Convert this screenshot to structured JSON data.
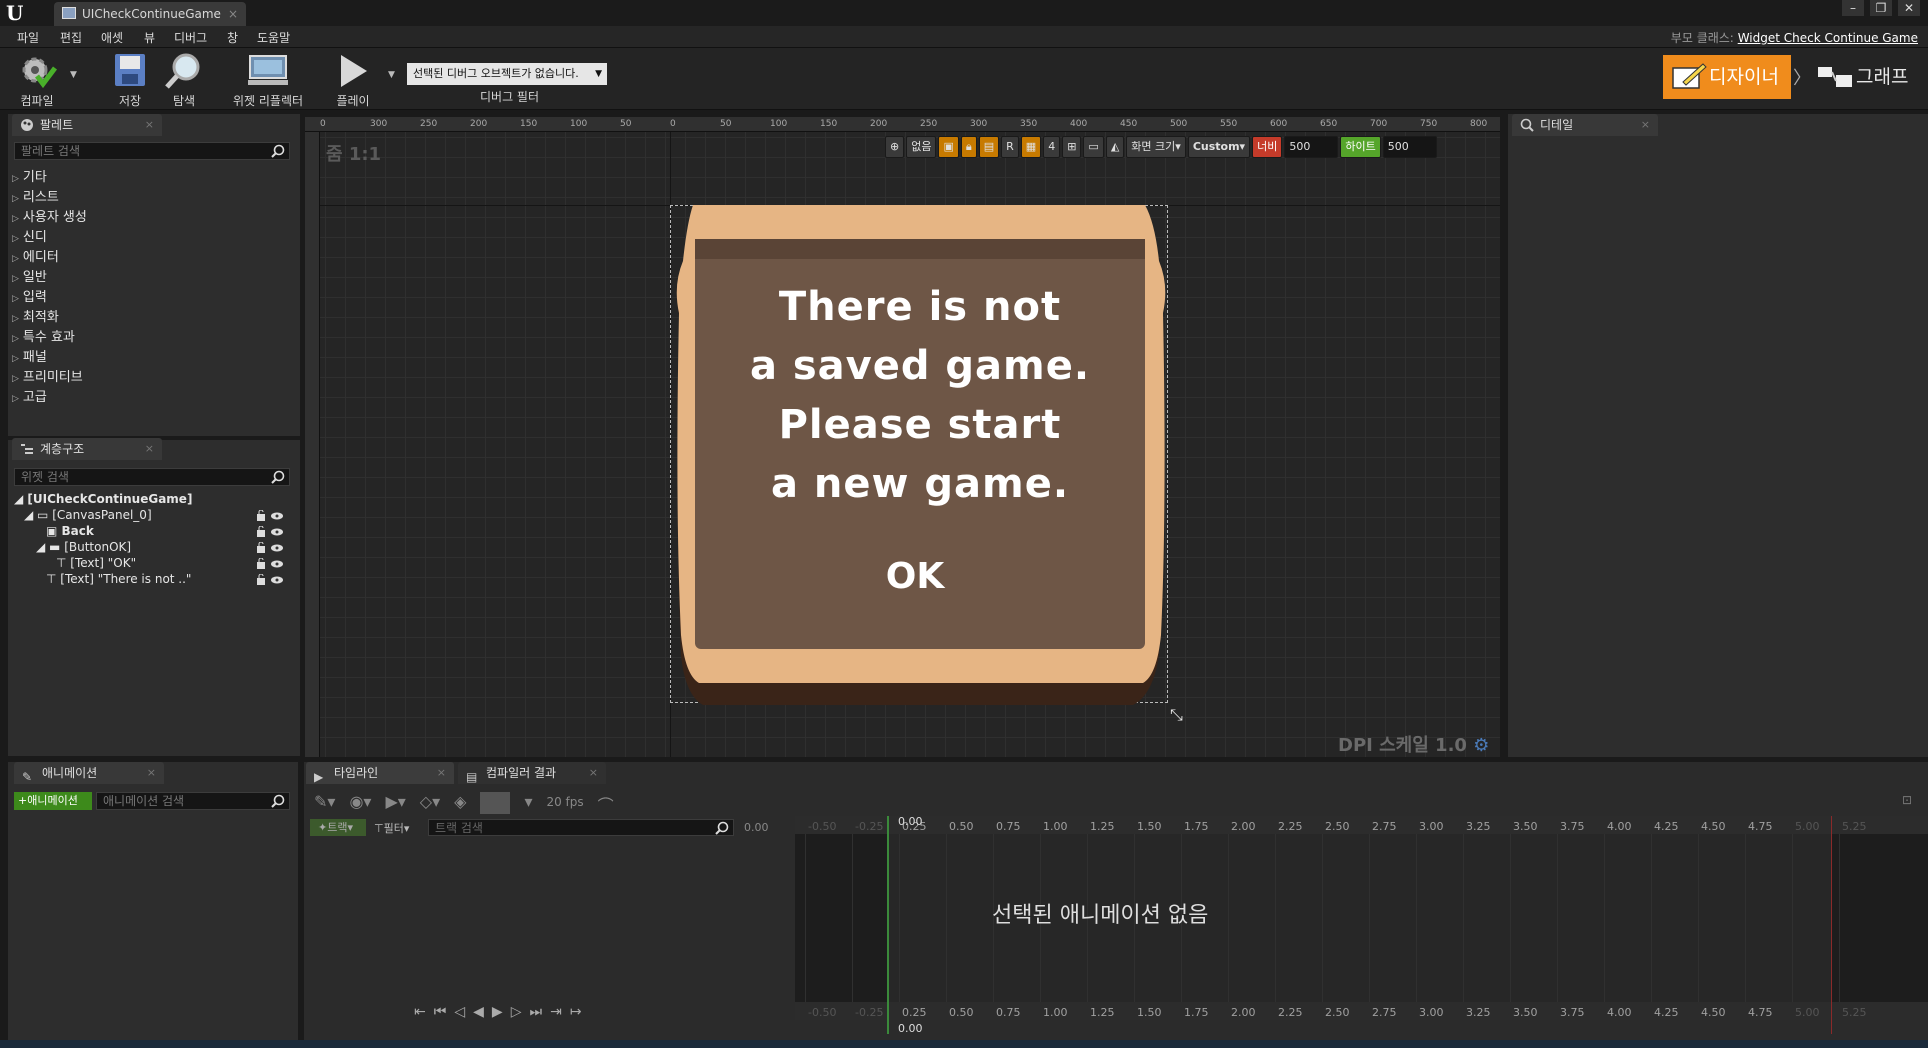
{
  "window": {
    "tab_title": "UICheckContinueGame",
    "parent_class_label": "부모 클래스:",
    "parent_class_value": "Widget Check Continue Game"
  },
  "menu": [
    "파일",
    "편집",
    "애셋",
    "뷰",
    "디버그",
    "창",
    "도움말"
  ],
  "toolbar": {
    "compile": "컴파일",
    "save": "저장",
    "browse": "탐색",
    "widget_reflector": "위젯 리플렉터",
    "play": "플레이",
    "debug_object": "선택된 디버그 오브젝트가 없습니다.",
    "debug_filter": "디버그 필터",
    "designer": "디자이너",
    "graph": "그래프"
  },
  "palette": {
    "tab": "팔레트",
    "search_placeholder": "팔레트 검색",
    "categories": [
      "기타",
      "리스트",
      "사용자 생성",
      "신디",
      "에디터",
      "일반",
      "입력",
      "최적화",
      "특수 효과",
      "패널",
      "프리미티브",
      "고급"
    ]
  },
  "hierarchy": {
    "tab": "계층구조",
    "search_placeholder": "위젯 검색",
    "items": [
      "[UICheckContinueGame]",
      "[CanvasPanel_0]",
      "Back",
      "[ButtonOK]",
      "[Text] \"OK\"",
      "[Text] \"There is not ..\""
    ]
  },
  "canvas": {
    "zoom": "줌 1:1",
    "dpi": "DPI 스케일 1.0",
    "none_label": "없음",
    "r_label": "R",
    "grid_num": "4",
    "screen_size": "화면 크기",
    "custom": "Custom",
    "width_label": "너비",
    "width_value": "500",
    "height_label": "하이트",
    "height_value": "500",
    "ruler_top": [
      "0",
      "300",
      "250",
      "200",
      "150",
      "100",
      "50",
      "0",
      "50",
      "100",
      "150",
      "200",
      "250",
      "300",
      "350",
      "400",
      "450",
      "500",
      "550",
      "600",
      "650",
      "700",
      "750",
      "800"
    ],
    "message_lines": [
      "There is not",
      "a saved game.",
      "Please start",
      "a new game."
    ],
    "ok_label": "OK"
  },
  "details": {
    "tab": "디테일"
  },
  "animations": {
    "tab": "애니메이션",
    "add_button": "+애니메이션",
    "search_placeholder": "애니메이션 검색"
  },
  "timeline": {
    "tab": "타임라인",
    "compiler_tab": "컴파일러 결과",
    "fps": "20 fps",
    "track_button": "트랙",
    "filter": "필터",
    "track_search_placeholder": "트랙 검색",
    "time_value": "0.00",
    "playhead_value": "0.00",
    "no_animation": "선택된 애니메이션 없음",
    "ticks": [
      "-0.50",
      "-0.25",
      "0.25",
      "0.50",
      "0.75",
      "1.00",
      "1.25",
      "1.50",
      "1.75",
      "2.00",
      "2.25",
      "2.50",
      "2.75",
      "3.00",
      "3.25",
      "3.50",
      "3.75",
      "4.00",
      "4.25",
      "4.50",
      "4.75",
      "5.00",
      "5.25"
    ]
  },
  "colors": {
    "accent": "#f08c1c",
    "panel_fill": "#6e5646",
    "panel_border": "#e8b888",
    "add_green": "#3d8a1b"
  }
}
